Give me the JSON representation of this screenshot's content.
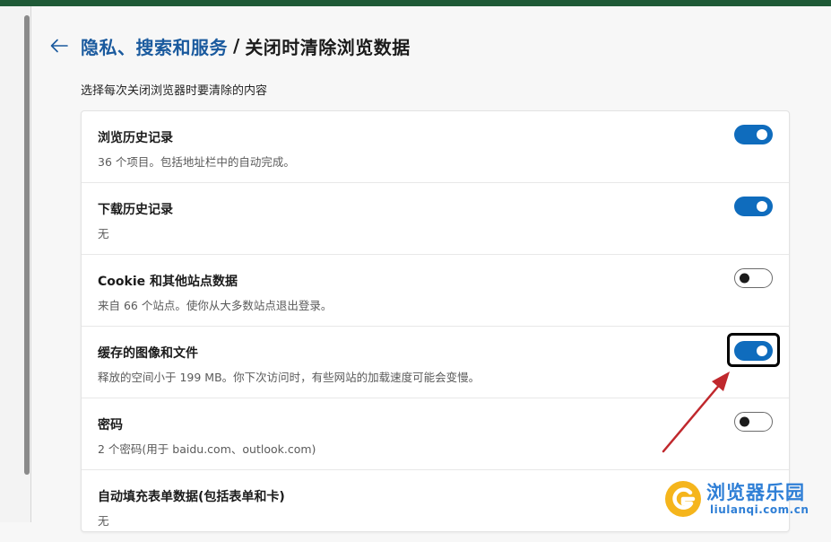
{
  "header": {
    "parent_link": "隐私、搜索和服务",
    "separator": "/",
    "current": "关闭时清除浏览数据"
  },
  "subtitle": "选择每次关闭浏览器时要清除的内容",
  "items": [
    {
      "title": "浏览历史记录",
      "desc": "36 个项目。包括地址栏中的自动完成。",
      "on": true
    },
    {
      "title": "下载历史记录",
      "desc": "无",
      "on": true
    },
    {
      "title": "Cookie 和其他站点数据",
      "desc": "来自 66 个站点。使你从大多数站点退出登录。",
      "on": false
    },
    {
      "title": "缓存的图像和文件",
      "desc": "释放的空间小于 199 MB。你下次访问时，有些网站的加载速度可能会变慢。",
      "on": true,
      "focused": true
    },
    {
      "title": "密码",
      "desc": "2 个密码(用于 baidu.com、outlook.com)",
      "on": false
    },
    {
      "title": "自动填充表单数据(包括表单和卡)",
      "desc": "无",
      "on": false
    }
  ],
  "watermark": {
    "main": "浏览器乐园",
    "sub": "liulanqi.com.cn"
  },
  "colors": {
    "accent": "#0f6cbd",
    "link": "#1a5a9e",
    "annotation_arrow": "#c0282d",
    "topbar": "#1f5a37"
  }
}
